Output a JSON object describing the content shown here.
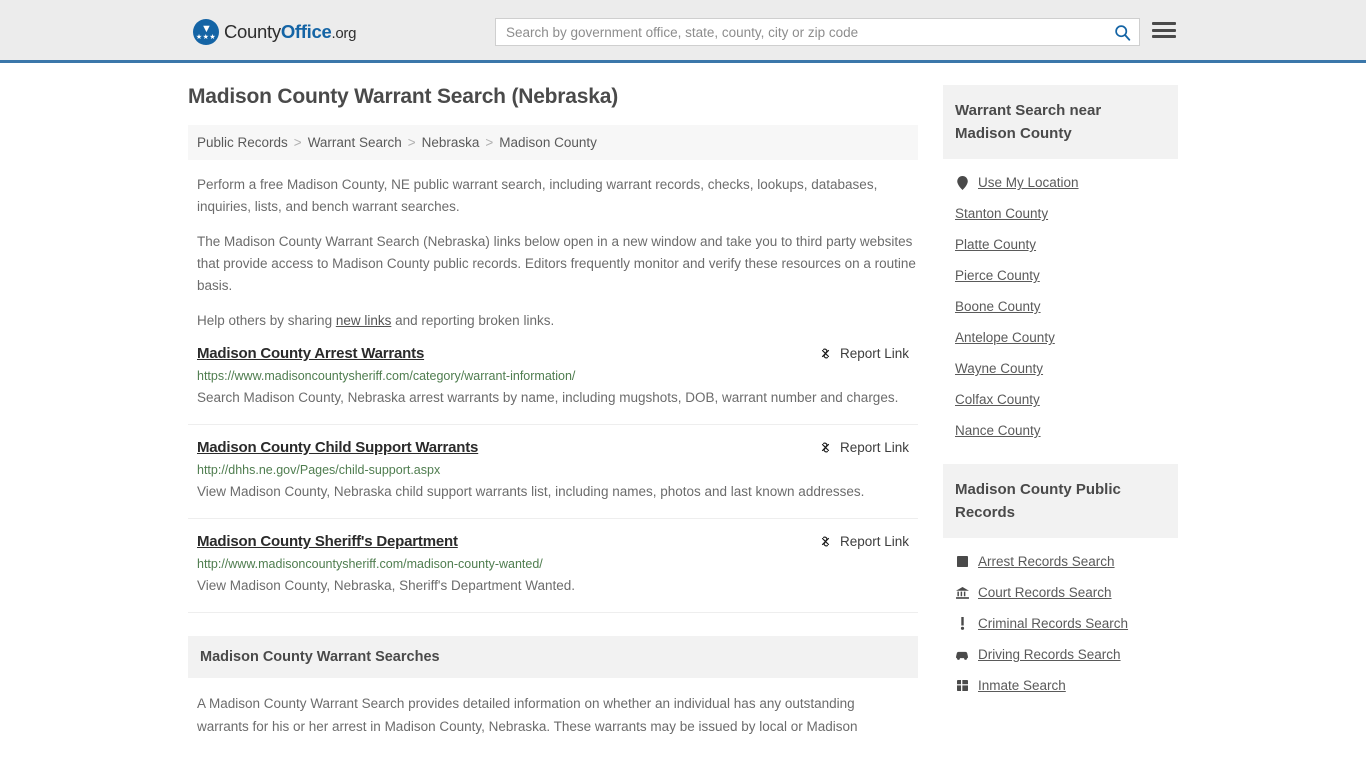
{
  "header": {
    "logo": {
      "part1": "County",
      "part2": "Office",
      "part3": ".org",
      "icon": "eagle-shield-icon"
    },
    "search": {
      "value": "",
      "placeholder": "Search by government office, state, county, city or zip code",
      "icon": "search-icon"
    },
    "menu": {
      "icon": "hamburger-menu-icon"
    },
    "accent_color": "#1464a5",
    "border_color": "#3b77aa"
  },
  "main": {
    "title": "Madison County Warrant Search (Nebraska)",
    "breadcrumb": [
      {
        "label": "Public Records",
        "current": false
      },
      {
        "label": "Warrant Search",
        "current": false
      },
      {
        "label": "Nebraska",
        "current": false
      },
      {
        "label": "Madison County",
        "current": true
      }
    ],
    "breadcrumb_separator": ">",
    "intro": {
      "p1": "Perform a free Madison County, NE public warrant search, including warrant records, checks, lookups, databases, inquiries, lists, and bench warrant searches.",
      "p2": "The Madison County Warrant Search (Nebraska) links below open in a new window and take you to third party websites that provide access to Madison County public records. Editors frequently monitor and verify these resources on a routine basis.",
      "p3_before": "Help others by sharing ",
      "p3_link": "new links",
      "p3_after": " and reporting broken links."
    },
    "report_link_label": "Report Link",
    "report_link_icon": "broken-link-icon",
    "results": [
      {
        "title": "Madison County Arrest Warrants",
        "url": "https://www.madisoncountysheriff.com/category/warrant-information/",
        "description": "Search Madison County, Nebraska arrest warrants by name, including mugshots, DOB, warrant number and charges."
      },
      {
        "title": "Madison County Child Support Warrants",
        "url": "http://dhhs.ne.gov/Pages/child-support.aspx",
        "description": "View Madison County, Nebraska child support warrants list, including names, photos and last known addresses."
      },
      {
        "title": "Madison County Sheriff's Department",
        "url": "http://www.madisoncountysheriff.com/madison-county-wanted/",
        "description": "View Madison County, Nebraska, Sheriff's Department Wanted."
      }
    ],
    "section": {
      "heading": "Madison County Warrant Searches",
      "body": "A Madison County Warrant Search provides detailed information on whether an individual has any outstanding warrants for his or her arrest in Madison County, Nebraska. These warrants may be issued by local or Madison"
    }
  },
  "sidebar": {
    "nearby": {
      "heading": "Warrant Search near Madison County",
      "items": [
        {
          "label": "Use My Location",
          "icon": "map-pin-icon"
        },
        {
          "label": "Stanton County",
          "icon": ""
        },
        {
          "label": "Platte County",
          "icon": ""
        },
        {
          "label": "Pierce County",
          "icon": ""
        },
        {
          "label": "Boone County",
          "icon": ""
        },
        {
          "label": "Antelope County",
          "icon": ""
        },
        {
          "label": "Wayne County",
          "icon": ""
        },
        {
          "label": "Colfax County",
          "icon": ""
        },
        {
          "label": "Nance County",
          "icon": ""
        }
      ]
    },
    "public_records": {
      "heading": "Madison County Public Records",
      "items": [
        {
          "label": "Arrest Records Search",
          "icon": "fingerprint-square-icon"
        },
        {
          "label": "Court Records Search",
          "icon": "courthouse-icon"
        },
        {
          "label": "Criminal Records Search",
          "icon": "exclamation-icon"
        },
        {
          "label": "Driving Records Search",
          "icon": "car-icon"
        },
        {
          "label": "Inmate Search",
          "icon": "inmate-icon"
        }
      ]
    }
  }
}
